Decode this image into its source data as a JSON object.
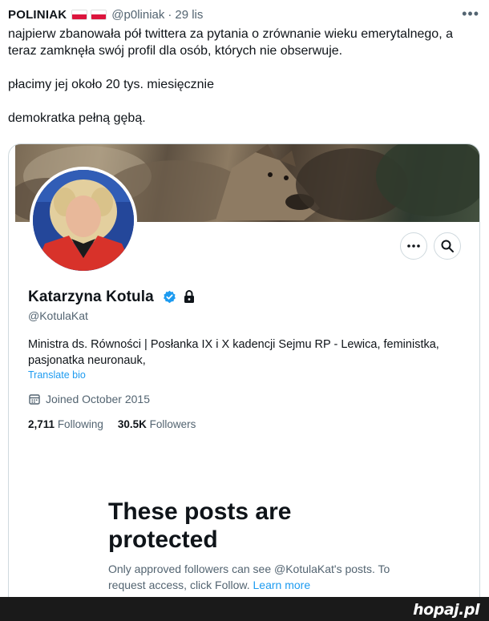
{
  "tweet": {
    "author_name": "POLINIAK",
    "handle": "@p0liniak",
    "separator": "·",
    "time": "29 lis",
    "more_icon": "more-horizontal-icon",
    "text_lines": [
      "najpierw zbanowała pół twittera za pytania o zrównanie wieku emerytalnego, a teraz zamknęła swój profil dla osób, których nie obserwuje.",
      "płacimy jej około 20 tys. miesięcznie",
      "demokratka pełną gębą."
    ]
  },
  "profile": {
    "display_name": "Katarzyna Kotula",
    "username": "@KotulaKat",
    "bio": "Ministra ds. Równości | Posłanka IX i X kadencji Sejmu RP - Lewica, feministka, pasjonatka neuronauk,",
    "translate_label": "Translate bio",
    "joined": "Joined October 2015",
    "following_count": "2,711",
    "following_label": "Following",
    "followers_count": "30.5K",
    "followers_label": "Followers",
    "protected_title": "These posts are protected",
    "protected_body": "Only approved followers can see @KotulaKat's posts. To request access, click Follow.",
    "learn_more": "Learn more"
  },
  "watermark": {
    "text": "hopaj.pl"
  },
  "colors": {
    "accent": "#1d9bf0",
    "text": "#0f1419",
    "muted": "#536471",
    "border": "#cfd9de",
    "flag_red": "#dc143c"
  }
}
